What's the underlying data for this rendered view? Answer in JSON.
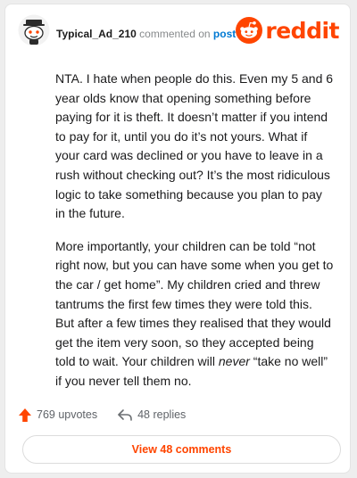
{
  "comment": {
    "username": "Typical_Ad_210",
    "action_text": "commented on",
    "post_link": "post",
    "paragraphs": [
      {
        "before": "NTA. I hate when people do this. Even my 5 and 6 year olds know that opening something before paying for it is theft. It doesn’t matter if you intend to pay for it, until you do it’s not yours. What if your card was declined or you have to leave in a rush without checking out? It’s the most ridiculous logic to take something because you plan to pay in the future.",
        "em": "",
        "after": ""
      },
      {
        "before": "More importantly, your children can be told “not right now, but you can have some when you get to the car / get home”. My children cried and threw tantrums the first few times they were told this. But after a few times they realised that they would get the item very soon, so they accepted being told to wait. Your children will ",
        "em": "never",
        "after": " “take no well” if you never tell them no."
      }
    ]
  },
  "brand": {
    "logo_text": "reddit",
    "color": "#ff4500"
  },
  "footer": {
    "upvotes": "769 upvotes",
    "replies": "48 replies",
    "view_comments": "View 48 comments"
  },
  "icons": {
    "avatar": "snoo-avatar-icon",
    "logo": "reddit-alien-icon",
    "upvote": "upvote-arrow-icon",
    "reply": "reply-arrow-icon"
  }
}
